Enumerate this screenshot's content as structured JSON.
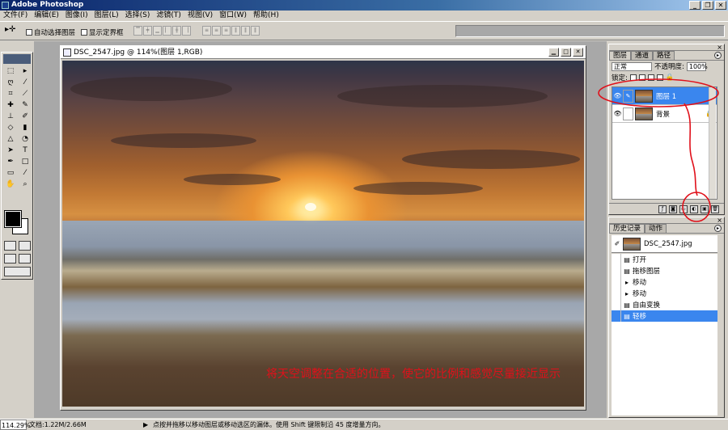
{
  "app": {
    "title": "Adobe Photoshop"
  },
  "menu": [
    "文件(F)",
    "编辑(E)",
    "图像(I)",
    "图层(L)",
    "选择(S)",
    "滤镜(T)",
    "视图(V)",
    "窗口(W)",
    "帮助(H)"
  ],
  "options_bar": {
    "auto_select_label": "自动选择图层",
    "show_bounds_label": "显示定界框"
  },
  "document": {
    "title": "DSC_2547.jpg @ 114%(图层 1,RGB)",
    "caption": "将天空调整在合适的位置，使它的比例和感觉尽量接近显示"
  },
  "layers_panel": {
    "tabs": [
      "图层",
      "通道",
      "路径"
    ],
    "blend_mode": "正常",
    "opacity_label": "不透明度:",
    "opacity_value": "100%",
    "lock_label": "锁定:",
    "layers": [
      {
        "name": "图层 1",
        "selected": true
      },
      {
        "name": "背景",
        "selected": false
      }
    ]
  },
  "history_panel": {
    "tabs": [
      "历史记录",
      "动作"
    ],
    "source": "DSC_2547.jpg",
    "items": [
      {
        "label": "打开",
        "current": false
      },
      {
        "label": "拖移图层",
        "current": false
      },
      {
        "label": "移动",
        "current": false
      },
      {
        "label": "移动",
        "current": false
      },
      {
        "label": "自由变换",
        "current": false
      },
      {
        "label": "轻移",
        "current": true
      }
    ]
  },
  "status_bar": {
    "zoom": "114.29%",
    "doc_info": "文档:1.22M/2.66M",
    "hint": "点按并拖移以移动图层或移动选区的漏体。使用 Shift 键限制沿 45 度增量方向。"
  },
  "colors": {
    "foreground": "#000000",
    "background": "#ffffff",
    "annotation": "#e0101a",
    "selection": "#3a86ee"
  }
}
